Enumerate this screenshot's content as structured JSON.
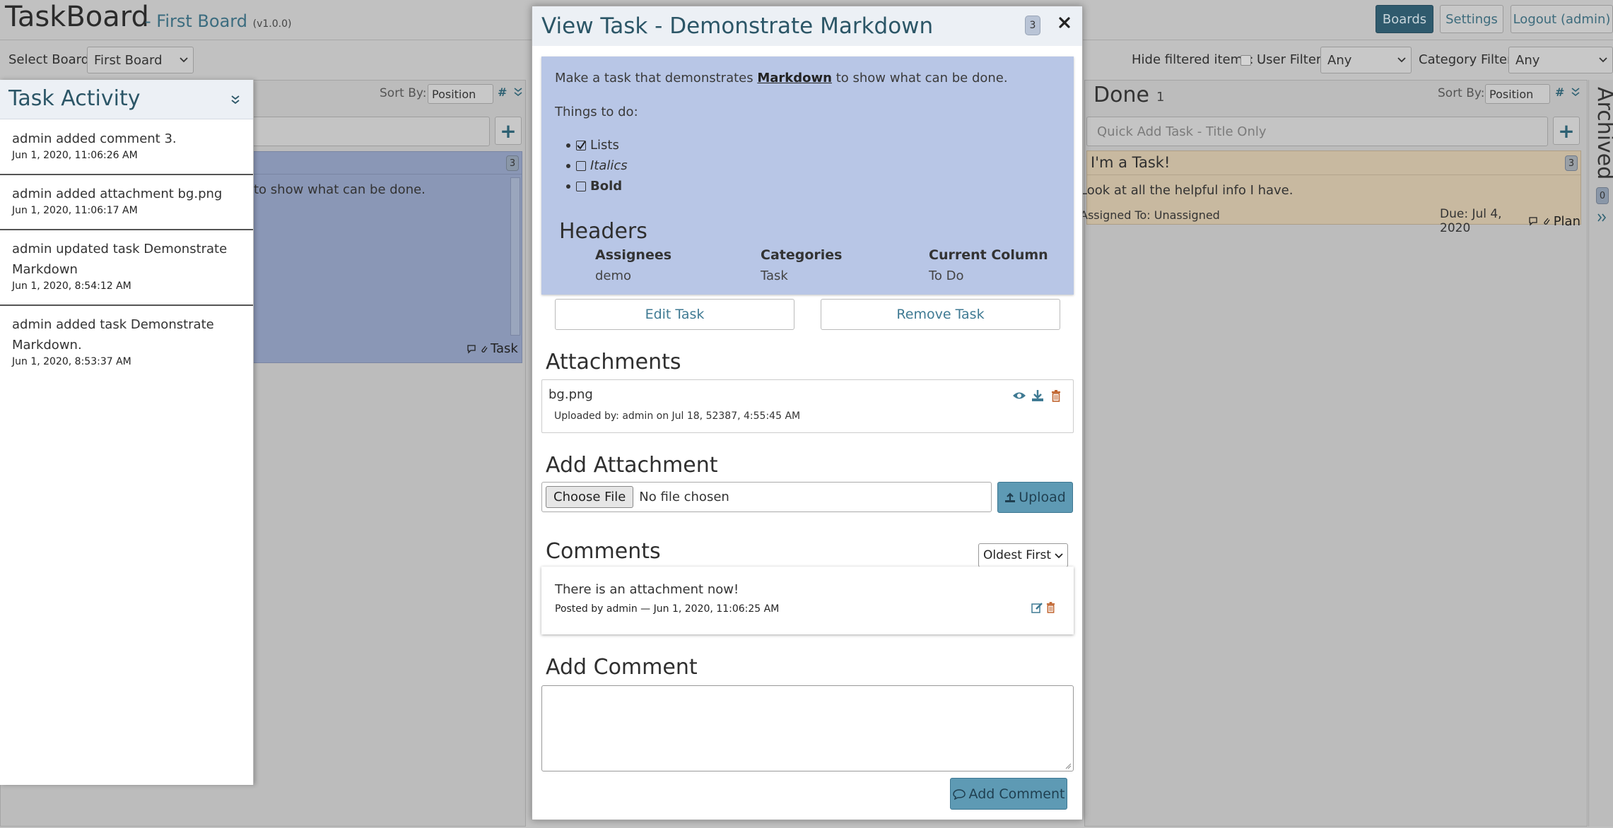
{
  "header": {
    "app_title": "TaskBoard",
    "board_name": "- First Board",
    "version": "(v1.0.0)",
    "nav": [
      "Boards",
      "Settings",
      "Logout (admin)"
    ]
  },
  "filters": {
    "select_board_label": "Select Board:",
    "select_board_value": "First Board",
    "hide_filtered_label": "Hide filtered items:",
    "user_filter_label": "User Filter:",
    "user_filter_value": "Any",
    "category_filter_label": "Category Filter:",
    "category_filter_value": "Any"
  },
  "left_column": {
    "sort_by_label": "Sort By:",
    "sort_value": "Position",
    "task_badge": "3",
    "task_excerpt": "to show what can be done.",
    "task_category": "Task"
  },
  "done_column": {
    "title": "Done",
    "count": "1",
    "sort_by_label": "Sort By:",
    "sort_value": "Position",
    "quick_add_placeholder": "Quick Add Task - Title Only",
    "task": {
      "title": "I'm a Task!",
      "badge": "3",
      "description": "Look at all the helpful info I have.",
      "assigned": "Assigned To: Unassigned",
      "due": "Due: Jul 4, 2020",
      "category": "Plan"
    }
  },
  "archived": {
    "label": "Archived",
    "count": "0"
  },
  "activity": {
    "title": "Task Activity",
    "items": [
      {
        "text": "admin added comment 3.",
        "date": "Jun 1, 2020, 11:06:26 AM"
      },
      {
        "text": "admin added attachment bg.png",
        "date": "Jun 1, 2020, 11:06:17 AM"
      },
      {
        "text": "admin updated task Demonstrate Markdown",
        "date": "Jun 1, 2020, 8:54:12 AM"
      },
      {
        "text": "admin added task Demonstrate Markdown.",
        "date": "Jun 1, 2020, 8:53:37 AM"
      }
    ]
  },
  "modal": {
    "title": "View Task - Demonstrate Markdown",
    "badge": "3",
    "description": {
      "intro_before": "Make a task that demonstrates",
      "intro_link": "Markdown",
      "intro_after": "to show what can be done.",
      "things_label": "Things to do:",
      "todos": [
        {
          "label": "Lists",
          "checked": true,
          "style": "normal"
        },
        {
          "label": "Italics",
          "checked": false,
          "style": "italic"
        },
        {
          "label": "Bold",
          "checked": false,
          "style": "bold"
        }
      ],
      "headers_title": "Headers",
      "table_headers": [
        "Assignees",
        "Categories",
        "Current Column"
      ],
      "table_values": [
        "demo",
        "Task",
        "To Do"
      ]
    },
    "edit_button": "Edit Task",
    "remove_button": "Remove Task",
    "attachments_title": "Attachments",
    "attachment": {
      "name": "bg.png",
      "meta": "Uploaded by: admin on Jul 18, 52387, 4:55:45 AM"
    },
    "add_attachment_title": "Add Attachment",
    "choose_file": "Choose File",
    "no_file": "No file chosen",
    "upload_button": "Upload",
    "comments_title": "Comments",
    "comment_sort": "Oldest First",
    "comment": {
      "text": "There is an attachment now!",
      "meta": "Posted by admin — Jun 1, 2020, 11:06:25 AM"
    },
    "add_comment_title": "Add Comment",
    "add_comment_button": "Add Comment"
  }
}
